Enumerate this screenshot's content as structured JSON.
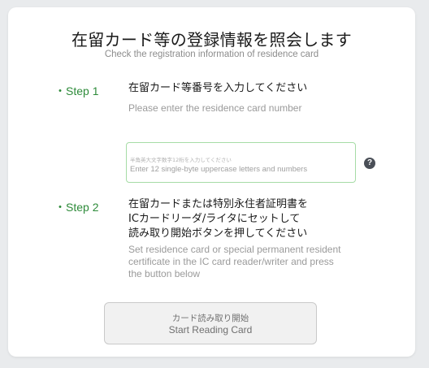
{
  "header": {
    "title": "在留カード等の登録情報を照会します",
    "subtitle": "Check the registration information of residence card"
  },
  "step1": {
    "label": "・Step 1",
    "title": "在留カード等番号を入力してください",
    "description": "Please enter the residence card number",
    "input": {
      "value": "",
      "placeholder_ja": "半角英大文字数字12桁を入力してください",
      "placeholder_en": "Enter 12 single-byte uppercase letters and numbers"
    },
    "help_icon_glyph": "?"
  },
  "step2": {
    "label": "・Step 2",
    "title_lines": [
      "在留カードまたは特別永住者証明書を",
      "ICカードリーダ/ライタにセットして",
      "読み取り開始ボタンを押してください"
    ],
    "description_lines": [
      "Set residence card or special permanent resident",
      "certificate in the IC card reader/writer and press",
      "the button below"
    ]
  },
  "start_button": {
    "label_ja": "カード読み取り開始",
    "label_en": "Start Reading Card",
    "state": "disabled"
  },
  "colors": {
    "background": "#e9ebed",
    "card": "#ffffff",
    "step_accent": "#2e8b3a",
    "input_border": "#a6dca6",
    "help_icon": "#4a4f57",
    "button_bg": "#f1f1f1"
  }
}
